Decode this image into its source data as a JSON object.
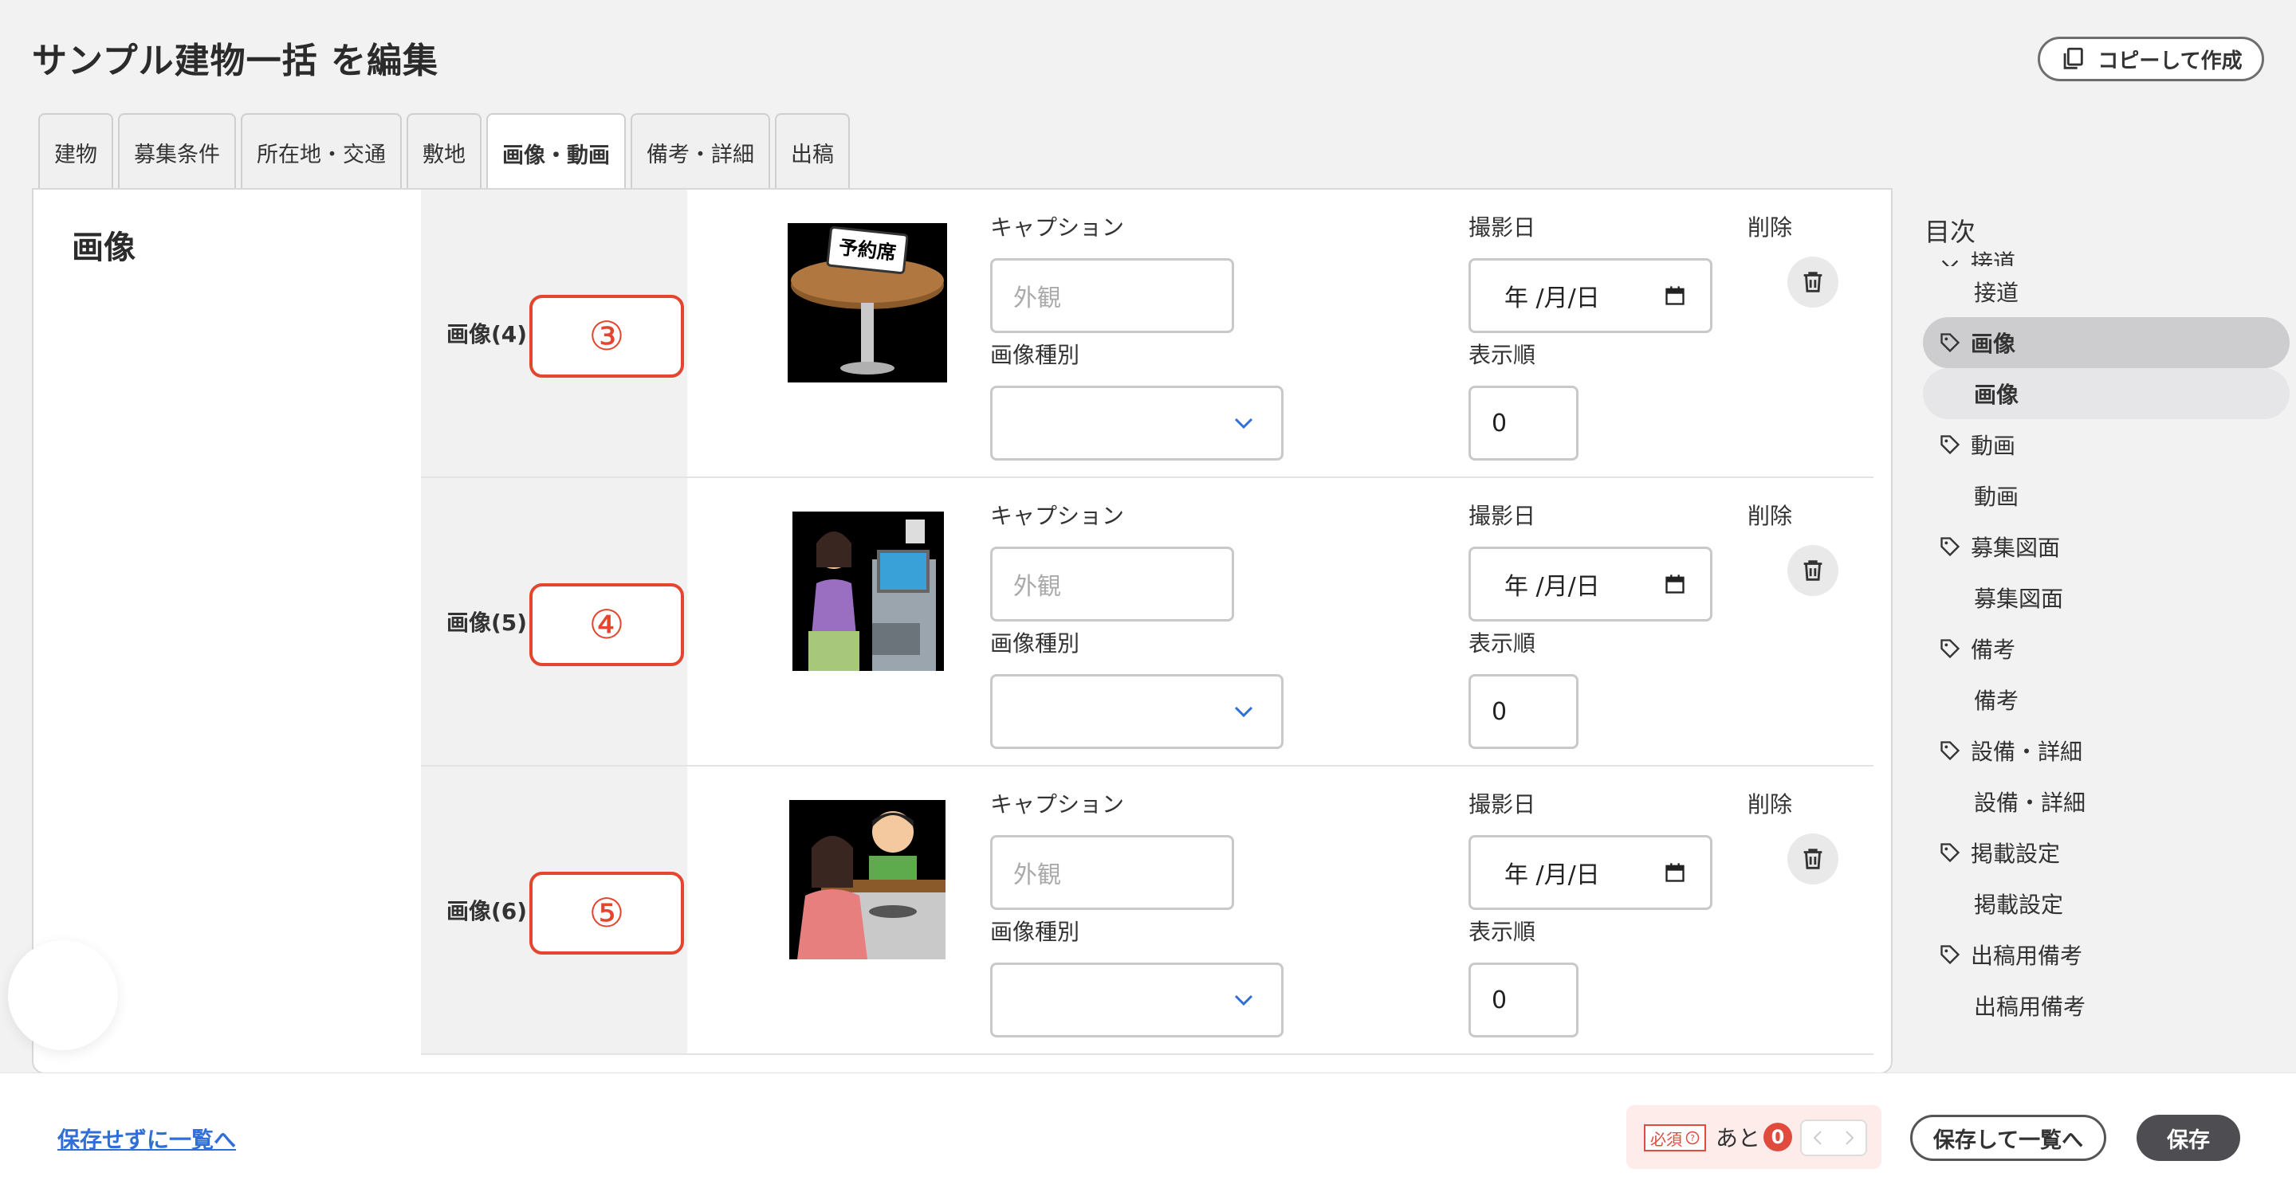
{
  "header": {
    "title": "サンプル建物一括 を編集",
    "copy_label": "コピーして作成"
  },
  "tabs": [
    {
      "label": "建物"
    },
    {
      "label": "募集条件"
    },
    {
      "label": "所在地・交通"
    },
    {
      "label": "敷地"
    },
    {
      "label": "画像・動画",
      "active": true
    },
    {
      "label": "備考・詳細"
    },
    {
      "label": "出稿"
    }
  ],
  "section": {
    "title": "画像"
  },
  "field_labels": {
    "caption": "キャプション",
    "date": "撮影日",
    "delete": "削除",
    "type": "画像種別",
    "order": "表示順"
  },
  "rows": [
    {
      "label": "画像(4)",
      "marker": "③",
      "caption_placeholder": "外観",
      "date_placeholder": "年 /月/日",
      "order": "0",
      "thumb": "reserved-table"
    },
    {
      "label": "画像(5)",
      "marker": "④",
      "caption_placeholder": "外観",
      "date_placeholder": "年 /月/日",
      "order": "0",
      "thumb": "self-checkout"
    },
    {
      "label": "画像(6)",
      "marker": "⑤",
      "caption_placeholder": "外観",
      "date_placeholder": "年 /月/日",
      "order": "0",
      "thumb": "counter-cooking"
    }
  ],
  "thumb_text": {
    "reserved": "予約席"
  },
  "toc": {
    "title": "目次",
    "items": [
      {
        "label": "接道",
        "level": "parent-cut"
      },
      {
        "label": "接道",
        "level": "child"
      },
      {
        "label": "画像",
        "level": "parent",
        "active": true
      },
      {
        "label": "画像",
        "level": "child",
        "active": true
      },
      {
        "label": "動画",
        "level": "parent"
      },
      {
        "label": "動画",
        "level": "child"
      },
      {
        "label": "募集図面",
        "level": "parent"
      },
      {
        "label": "募集図面",
        "level": "child"
      },
      {
        "label": "備考",
        "level": "parent"
      },
      {
        "label": "備考",
        "level": "child"
      },
      {
        "label": "設備・詳細",
        "level": "parent"
      },
      {
        "label": "設備・詳細",
        "level": "child"
      },
      {
        "label": "掲載設定",
        "level": "parent"
      },
      {
        "label": "掲載設定",
        "level": "child"
      },
      {
        "label": "出稿用備考",
        "level": "parent"
      },
      {
        "label": "出稿用備考",
        "level": "child"
      }
    ]
  },
  "footer": {
    "back_link": "保存せずに一覧へ",
    "required_badge": "必須",
    "remaining_label": "あと",
    "remaining_count": "0",
    "save_and_list": "保存して一覧へ",
    "save": "保存"
  },
  "colors": {
    "accent_red": "#e4452f",
    "link_blue": "#2f6fd6",
    "primary_button": "#4d4d52"
  }
}
